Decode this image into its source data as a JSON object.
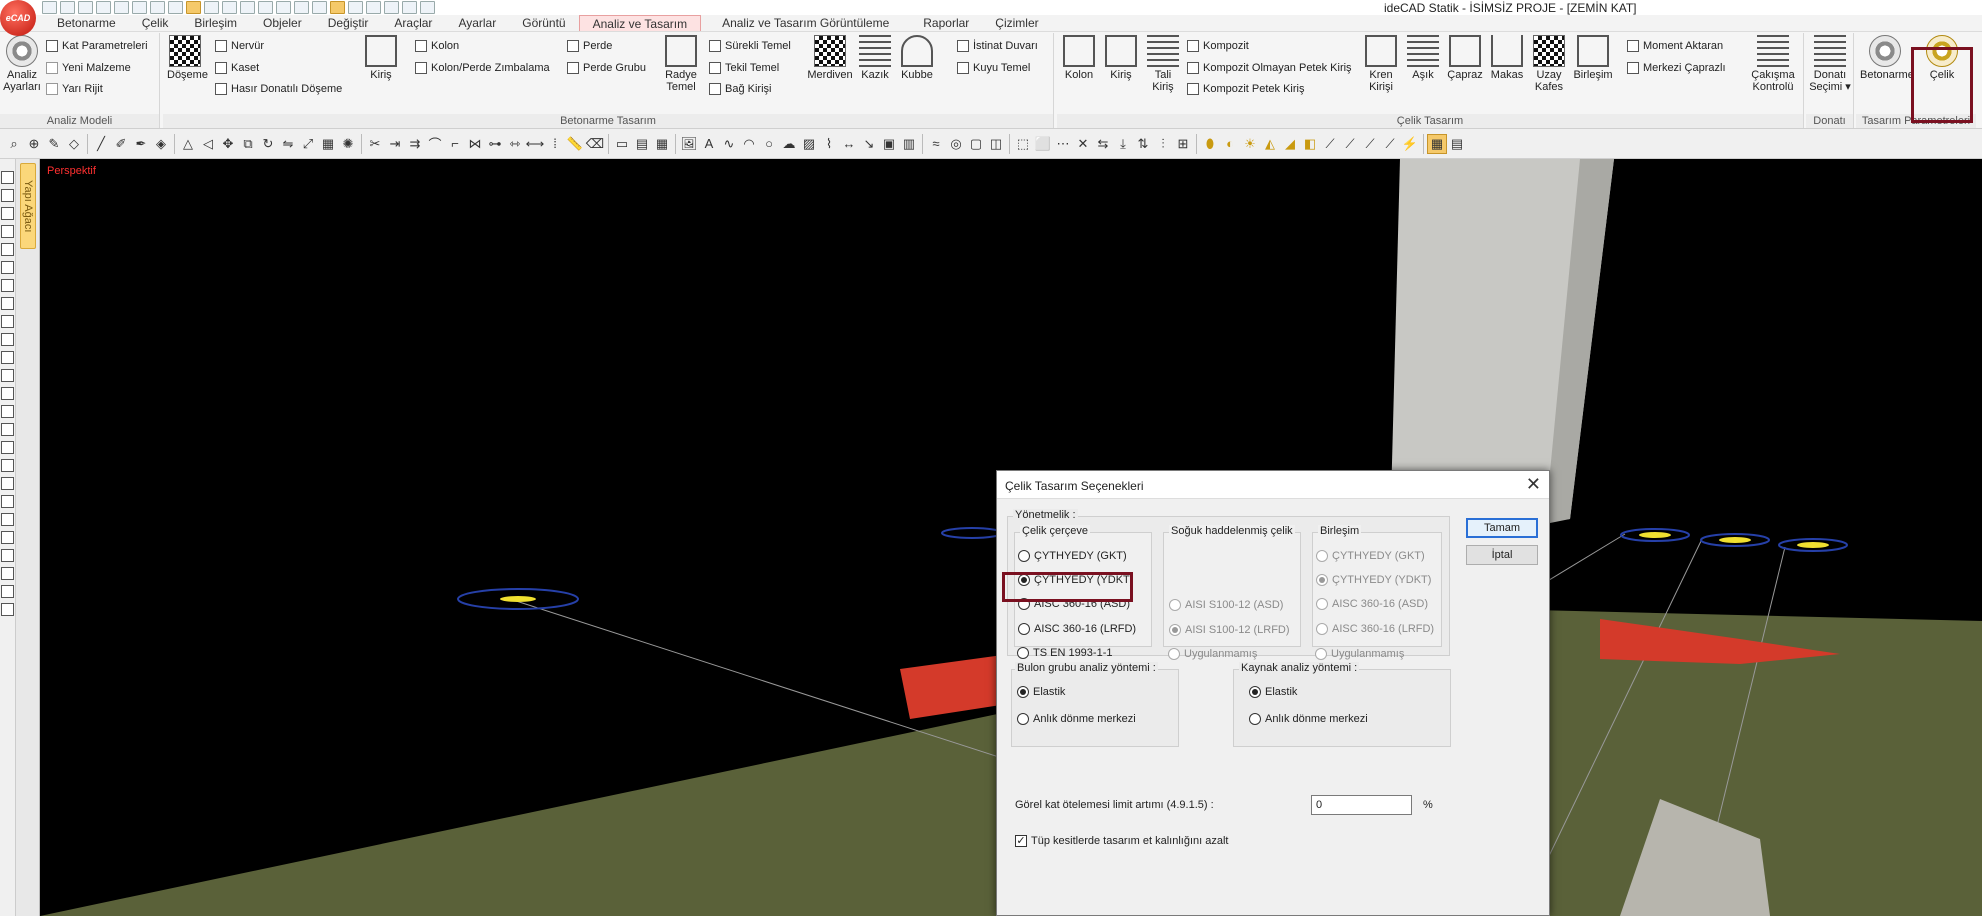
{
  "window": {
    "title": "ideCAD Statik - İSİMSİZ PROJE - [ZEMİN KAT]",
    "logo_text": "eCAD"
  },
  "menu": {
    "tabs": [
      "Betonarme",
      "Çelik",
      "Birleşim",
      "Objeler",
      "Değiştir",
      "Araçlar",
      "Ayarlar",
      "Görüntü",
      "Analiz ve Tasarım",
      "Analiz ve Tasarım Görüntüleme",
      "Raporlar",
      "Çizimler"
    ],
    "active": "Analiz ve Tasarım"
  },
  "ribbon": {
    "groups": {
      "analiz_modeli": "Analiz Modeli",
      "betonarme_tasarim": "Betonarme Tasarım",
      "celik_tasarim": "Çelik Tasarım",
      "donati": "Donatı",
      "tasarim_param": "Tasarım Parametreleri"
    },
    "analiz_ayarlari": "Analiz Ayarları",
    "kat_parametreleri": "Kat Parametreleri",
    "yeni_malzeme": "Yeni Malzeme",
    "yari_rijit": "Yarı Rijit",
    "doseme": "Döşeme",
    "nervur": "Nervür",
    "kaset": "Kaset",
    "hasir": "Hasır Donatılı Döşeme",
    "kiris": "Kiriş",
    "kolon": "Kolon",
    "kolon_perde": "Kolon/Perde Zımbalama",
    "perde": "Perde",
    "perde_grubu": "Perde Grubu",
    "radye": "Radye Temel",
    "surekli_temel": "Sürekli Temel",
    "tekil_temel": "Tekil Temel",
    "bag_kirisi": "Bağ Kirişi",
    "merdiven": "Merdiven",
    "kazik": "Kazık",
    "kubbe": "Kubbe",
    "istinat": "İstinat Duvarı",
    "kuyu": "Kuyu Temel",
    "c_kolon": "Kolon",
    "c_kiris": "Kiriş",
    "tali_kiris": "Tali Kiriş",
    "kompozit": "Kompozit",
    "kompozit_olmayan": "Kompozit Olmayan Petek Kiriş",
    "kompozit_petek": "Kompozit Petek Kiriş",
    "kren": "Kren Kirişi",
    "asik": "Aşık",
    "capraz": "Çapraz",
    "makas": "Makas",
    "uzay": "Uzay Kafes",
    "birlesim": "Birleşim",
    "moment": "Moment Aktaran",
    "merkezi": "Merkezi Çaprazlı",
    "cakisma": "Çakışma Kontrolü",
    "donati_secimi": "Donatı Seçimi",
    "betonarme": "Betonarme",
    "celik": "Çelik"
  },
  "viewport": {
    "label": "Perspektif",
    "side_tab": "Yapı Ağacı"
  },
  "dialog": {
    "title": "Çelik Tasarım Seçenekleri",
    "close": "✕",
    "regulation_label": "Yönetmelik :",
    "frame": {
      "title": "Çelik çerçeve",
      "options": [
        "ÇYTHYEDY (GKT)",
        "ÇYTHYEDY (YDKT)",
        "AISC 360-16 (ASD)",
        "AISC 360-16 (LRFD)",
        "TS EN 1993-1-1"
      ],
      "selected": 1
    },
    "cold": {
      "title": "Soğuk haddelenmiş çelik",
      "options": [
        "AISI S100-12 (ASD)",
        "AISI S100-12 (LRFD)",
        "Uygulanmamış"
      ],
      "selected": 1
    },
    "conn": {
      "title": "Birleşim",
      "options": [
        "ÇYTHYEDY (GKT)",
        "ÇYTHYEDY (YDKT)",
        "AISC 360-16 (ASD)",
        "AISC 360-16 (LRFD)",
        "Uygulanmamış"
      ],
      "selected": 1
    },
    "bolt": {
      "title": "Bulon grubu analiz yöntemi :",
      "options": [
        "Elastik",
        "Anlık dönme merkezi"
      ],
      "selected": 0
    },
    "weld": {
      "title": "Kaynak analiz yöntemi :",
      "options": [
        "Elastik",
        "Anlık dönme merkezi"
      ],
      "selected": 0
    },
    "drift_label": "Görel kat ötelemesi limit artımı (4.9.1.5) :",
    "drift_value": "0",
    "drift_unit": "%",
    "tube_label": "Tüp kesitlerde tasarım et kalınlığını azalt",
    "tube_checked": true,
    "ok": "Tamam",
    "cancel": "İptal"
  }
}
